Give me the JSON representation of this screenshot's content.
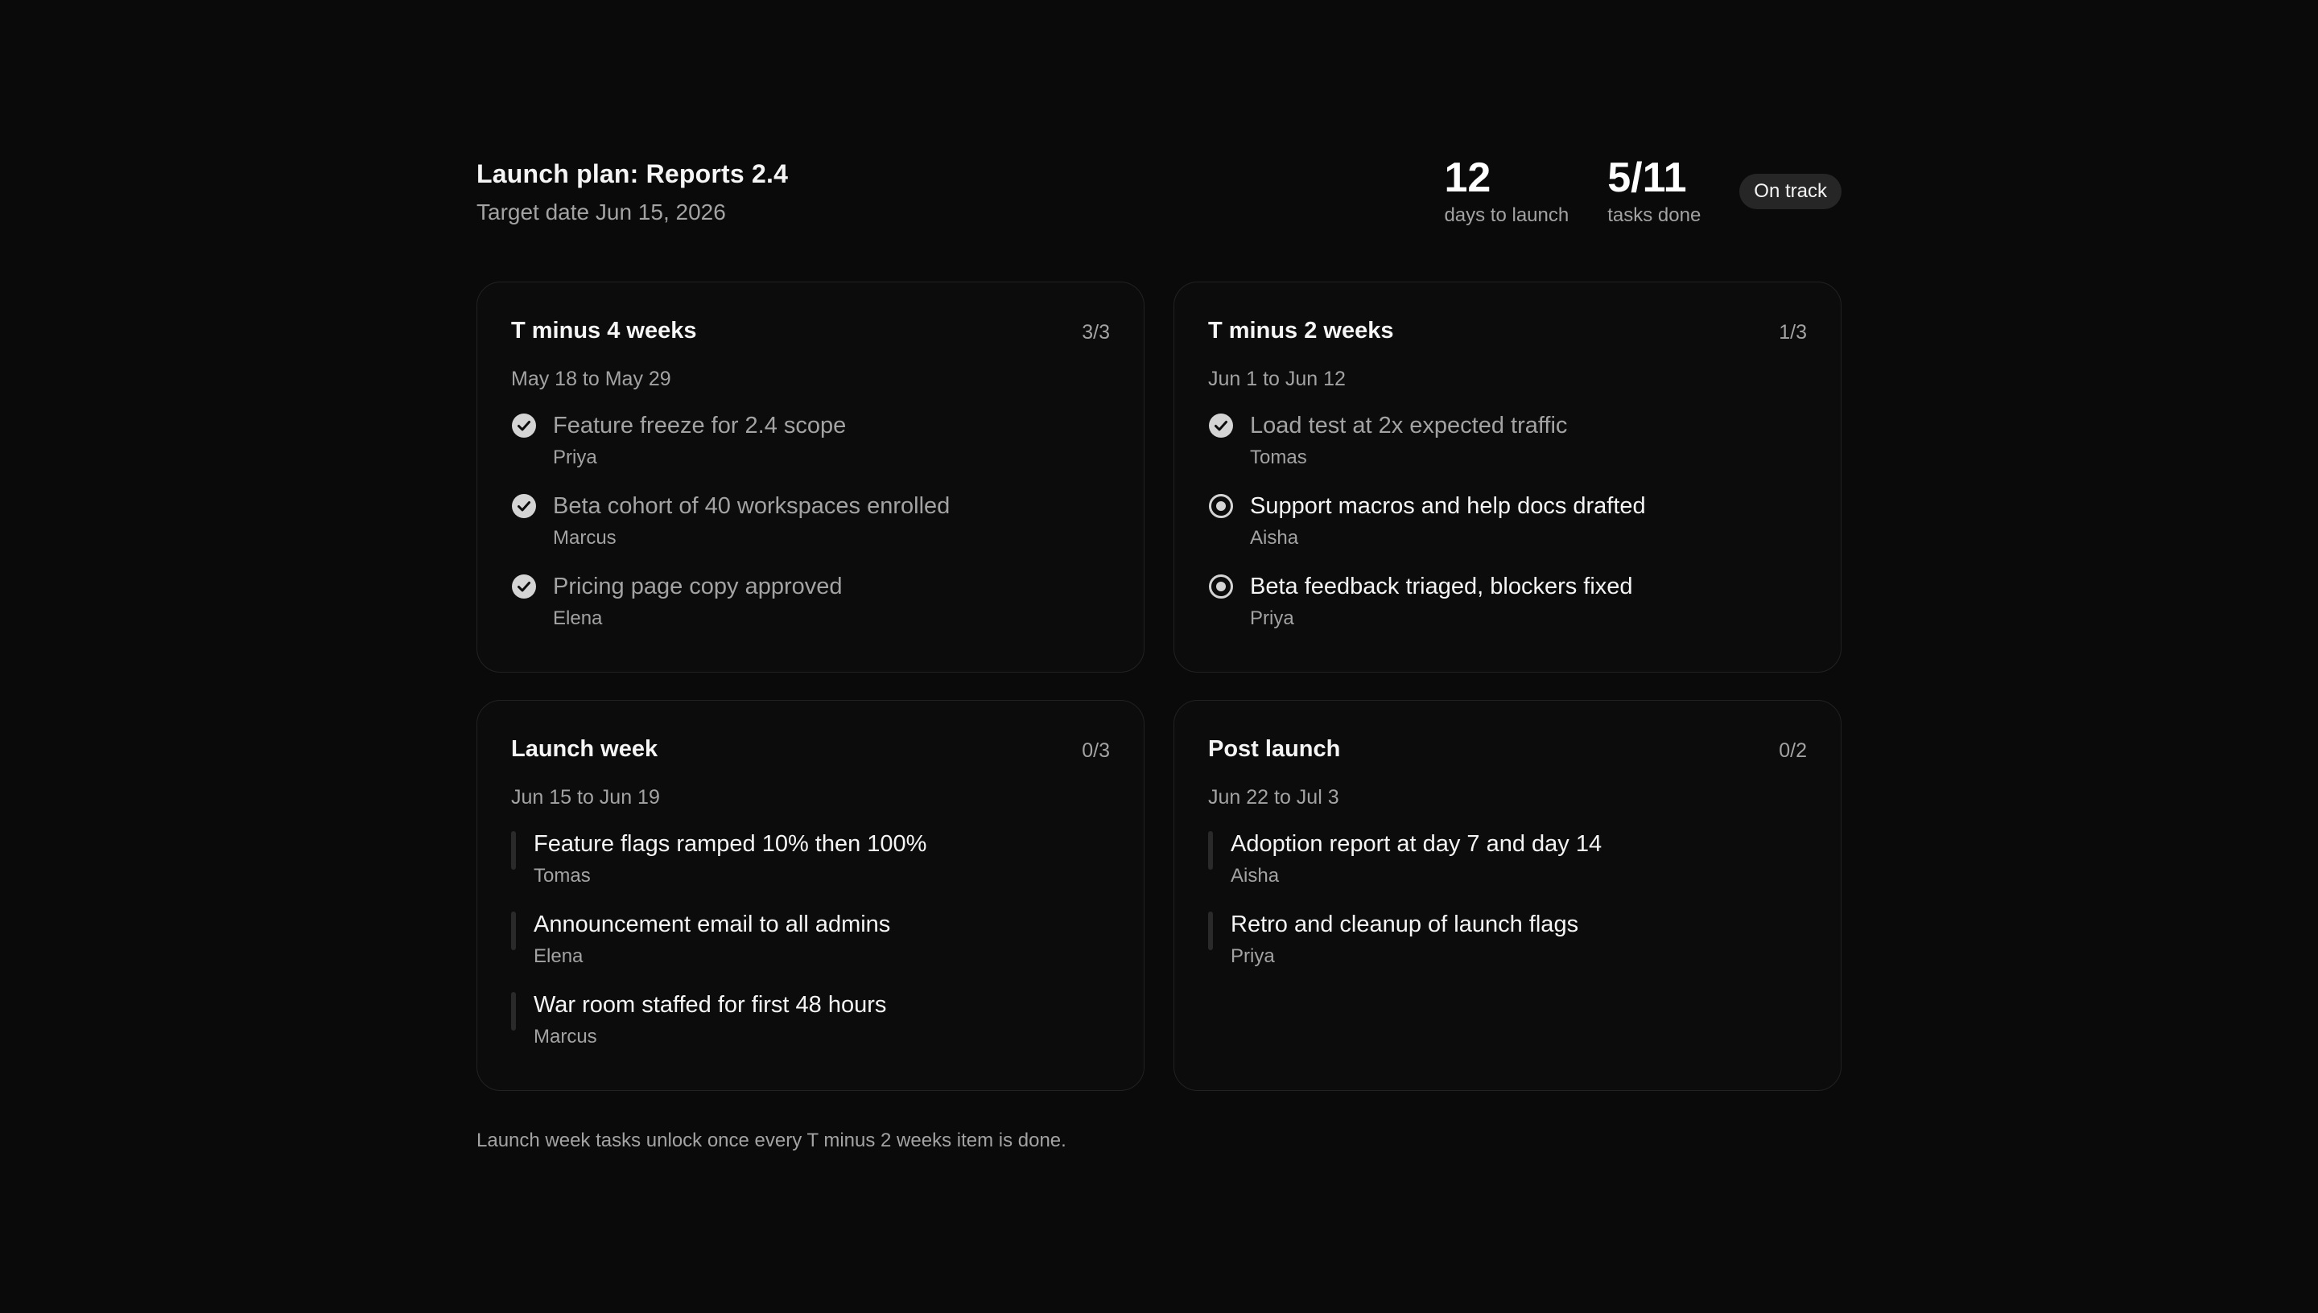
{
  "header": {
    "title": "Launch plan: Reports 2.4",
    "subtitle": "Target date Jun 15, 2026",
    "stats": [
      {
        "value": "12",
        "label": "days to launch"
      },
      {
        "value": "5/11",
        "label": "tasks done"
      }
    ],
    "badge": "On track"
  },
  "phases": [
    {
      "title": "T minus 4 weeks",
      "count": "3/3",
      "range": "May 18 to May 29",
      "tasks": [
        {
          "text": "Feature freeze for 2.4 scope",
          "owner": "Priya",
          "status": "done",
          "icon": "check-circle-icon"
        },
        {
          "text": "Beta cohort of 40 workspaces enrolled",
          "owner": "Marcus",
          "status": "done",
          "icon": "check-circle-icon"
        },
        {
          "text": "Pricing page copy approved",
          "owner": "Elena",
          "status": "done",
          "icon": "check-circle-icon"
        }
      ]
    },
    {
      "title": "T minus 2 weeks",
      "count": "1/3",
      "range": "Jun 1 to Jun 12",
      "tasks": [
        {
          "text": "Load test at 2x expected traffic",
          "owner": "Tomas",
          "status": "done",
          "icon": "check-circle-icon"
        },
        {
          "text": "Support macros and help docs drafted",
          "owner": "Aisha",
          "status": "active",
          "icon": "in-progress-ring-icon"
        },
        {
          "text": "Beta feedback triaged, blockers fixed",
          "owner": "Priya",
          "status": "active",
          "icon": "in-progress-ring-icon"
        }
      ]
    },
    {
      "title": "Launch week",
      "count": "0/3",
      "range": "Jun 15 to Jun 19",
      "tasks": [
        {
          "text": "Feature flags ramped 10% then 100%",
          "owner": "Tomas",
          "status": "pending",
          "icon": "pending-bar-icon"
        },
        {
          "text": "Announcement email to all admins",
          "owner": "Elena",
          "status": "pending",
          "icon": "pending-bar-icon"
        },
        {
          "text": "War room staffed for first 48 hours",
          "owner": "Marcus",
          "status": "pending",
          "icon": "pending-bar-icon"
        }
      ]
    },
    {
      "title": "Post launch",
      "count": "0/2",
      "range": "Jun 22 to Jul 3",
      "tasks": [
        {
          "text": "Adoption report at day 7 and day 14",
          "owner": "Aisha",
          "status": "pending",
          "icon": "pending-bar-icon"
        },
        {
          "text": "Retro and cleanup of launch flags",
          "owner": "Priya",
          "status": "pending",
          "icon": "pending-bar-icon"
        }
      ]
    }
  ],
  "footnote": "Launch week tasks unlock once every T minus 2 weeks item is done.",
  "colors": {
    "background": "#0a0a0a",
    "card_border": "#222222",
    "text_primary": "#f5f5f5",
    "text_muted": "#a3a3a3",
    "badge_bg": "#262626",
    "done_icon_fill": "#d4d4d4",
    "pending_bar": "#2a2a2a"
  }
}
